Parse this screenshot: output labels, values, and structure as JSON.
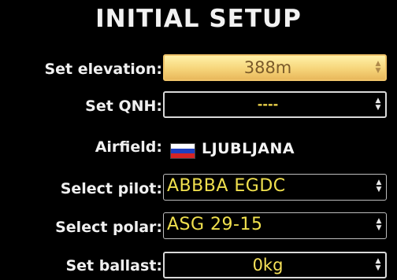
{
  "screen": {
    "title": "INITIAL SETUP"
  },
  "rows": {
    "elevation": {
      "label": "Set elevation:",
      "value": "388m"
    },
    "qnh": {
      "label": "Set QNH:",
      "value": "----"
    },
    "airfield": {
      "label": "Airfield:",
      "value": "LJUBLJANA",
      "flag": "slovenia-flag"
    },
    "pilot": {
      "label": "Select pilot:",
      "value": "ABBBA EGDC"
    },
    "polar": {
      "label": "Select polar:",
      "value": "ASG 29-15"
    },
    "ballast": {
      "label": "Set ballast:",
      "value": "0kg"
    }
  },
  "colors": {
    "active_field_top": "#fff1a8",
    "active_field_bottom": "#e9b85c",
    "value_text": "#f7e25a",
    "background": "#000000"
  },
  "icons": {
    "stepper": "up-down-stepper-icon"
  }
}
